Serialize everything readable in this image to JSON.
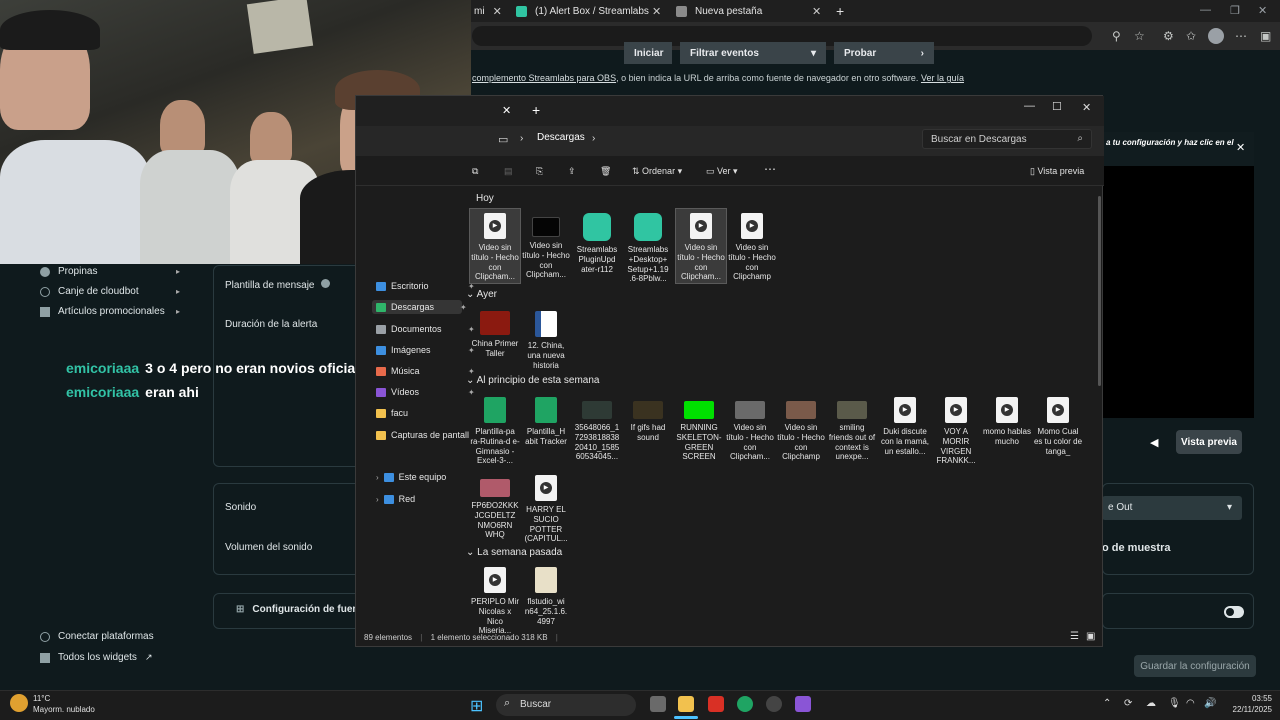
{
  "browser": {
    "tabs": [
      {
        "label": "mi"
      },
      {
        "label": "(1) Alert Box / Streamlabs"
      },
      {
        "label": "Nueva pestaña"
      }
    ],
    "new_tab": "+",
    "close": "✕"
  },
  "streamlabs": {
    "buttons": {
      "iniciar": "Iniciar",
      "filtrar": "Filtrar eventos",
      "probar": "Probar"
    },
    "hint": {
      "link1": "complemento Streamlabs para OBS",
      "middle": ", o bien indica la URL de arriba como fuente de navegador en otro software.",
      "link2": "Ver la guía"
    },
    "sidebar": [
      {
        "label": "Propinas"
      },
      {
        "label": "Canje de cloudbot"
      },
      {
        "label": "Artículos promocionales"
      }
    ],
    "bottom_links": {
      "connect": "Conectar plataformas",
      "widgets": "Todos los widgets"
    },
    "form": {
      "plantilla": "Plantilla de mensaje",
      "duracion": "Duración de la alerta",
      "sonido": "Sonido",
      "volumen": "Volumen del sonido",
      "config_fuente": "Configuración de fuente"
    },
    "preview": {
      "top_text": "a tu configuración y haz clic en el",
      "button": "Vista previa",
      "select_value": "e Out",
      "muestra": "o de muestra"
    },
    "save": "Guardar la configuración"
  },
  "chat": [
    {
      "user": "emicoriaaa",
      "msg": "3 o 4 pero no eran novios oficiales"
    },
    {
      "user": "emicoriaaa",
      "msg": "eran ahi"
    }
  ],
  "explorer": {
    "breadcrumb": "Descargas",
    "search_placeholder": "Buscar en Descargas",
    "commands": {
      "ordenar": "Ordenar",
      "ver": "Ver",
      "vista_previa": "Vista previa"
    },
    "nav": [
      {
        "label": "Escritorio"
      },
      {
        "label": "Descargas"
      },
      {
        "label": "Documentos"
      },
      {
        "label": "Imágenes"
      },
      {
        "label": "Música"
      },
      {
        "label": "Vídeos"
      },
      {
        "label": "facu"
      },
      {
        "label": "Capturas de pantall"
      },
      {
        "label": "Este equipo"
      },
      {
        "label": "Red"
      }
    ],
    "groups": {
      "hoy": "Hoy",
      "ayer": "Ayer",
      "semana": "Al principio de esta semana",
      "pasada": "La semana pasada"
    },
    "files_hoy": [
      {
        "name": "Video sin título - Hecho con Clipcham..."
      },
      {
        "name": "Video sin título - Hecho con Clipcham..."
      },
      {
        "name": "Streamlabs PluginUpd ater-r112"
      },
      {
        "name": "Streamlabs +Desktop+ Setup+1.19 .6-8Pblw..."
      },
      {
        "name": "Video sin título - Hecho con Clipcham..."
      },
      {
        "name": "Video sin título - Hecho con Clipchamp"
      }
    ],
    "files_ayer": [
      {
        "name": "China Primer Taller"
      },
      {
        "name": "12. China, una nueva historia"
      }
    ],
    "files_semana": [
      {
        "name": "Plantilla-pa ra-Rutina-d e-Gimnasio -Excel-3-..."
      },
      {
        "name": "Plantilla_H abit Tracker"
      },
      {
        "name": "35648066_1 7293818838 20410_1585 60534045..."
      },
      {
        "name": "If gifs had sound"
      },
      {
        "name": "RUNNING SKELETON- GREEN SCREEN"
      },
      {
        "name": "Video sin título - Hecho con Clipcham..."
      },
      {
        "name": "Video sin título - Hecho con Clipchamp"
      },
      {
        "name": "smiling friends out of context is unexpe..."
      },
      {
        "name": "Duki discute con la mamá, un estallo..."
      },
      {
        "name": "VOY A MORIR VIRGEN FRANKK..."
      },
      {
        "name": "momo hablas mucho"
      },
      {
        "name": "Momo Cual es tu color de tanga_"
      },
      {
        "name": "FP6ĐO2KKK JCGDELTZ NMO6RN WHQ"
      },
      {
        "name": "HARRY EL SUCIO POTTER (CAPITUL..."
      }
    ],
    "files_pasada": [
      {
        "name": "PERIPLO Mir Nicolas x Nico Miseria..."
      },
      {
        "name": "flstudio_wi n64_25.1.6. 4997"
      }
    ],
    "status": {
      "count": "89 elementos",
      "selected": "1 elemento seleccionado  318 KB"
    }
  },
  "taskbar": {
    "weather_temp": "11°C",
    "weather_desc": "Mayorm. nublado",
    "search": "Buscar",
    "time": "03:55",
    "date": "22/11/2025"
  },
  "colors": {
    "accent": "#32c3a6",
    "page_bg": "#0f1a1d",
    "explorer_bg": "#1c1c1c"
  }
}
